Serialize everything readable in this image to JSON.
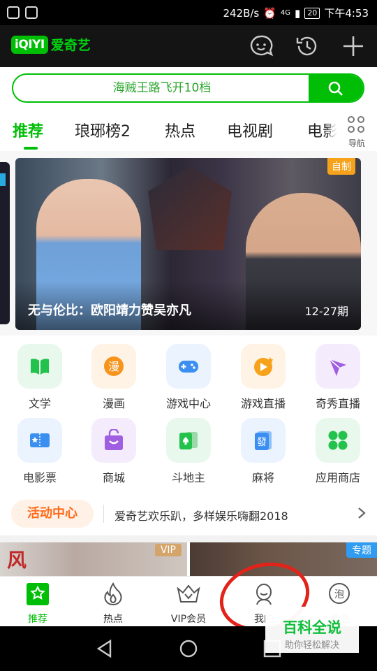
{
  "status": {
    "net_speed": "242B/s",
    "signal": "4G",
    "battery": "20",
    "time": "下午4:53"
  },
  "header": {
    "logo_mark": "iQIYI",
    "logo_name": "爱奇艺",
    "icons": [
      "message-icon",
      "history-icon",
      "plus-icon"
    ]
  },
  "search": {
    "placeholder": "海贼王路飞开10档"
  },
  "tabs": [
    {
      "label": "推荐"
    },
    {
      "label": "琅琊榜2"
    },
    {
      "label": "热点"
    },
    {
      "label": "电视剧"
    },
    {
      "label": "电影"
    }
  ],
  "nav": {
    "label": "导航"
  },
  "banner": {
    "tag": "自制",
    "title": "无与伦比：欧阳靖力赞吴亦凡",
    "episode": "12-27期"
  },
  "grid": [
    {
      "label": "文学",
      "icon": "book-icon",
      "color": "#22c24c"
    },
    {
      "label": "漫画",
      "icon": "comic-icon",
      "color": "#f6941d"
    },
    {
      "label": "游戏中心",
      "icon": "gamepad-icon",
      "color": "#3b8ff0"
    },
    {
      "label": "游戏直播",
      "icon": "play-star-icon",
      "color": "#f7a21b"
    },
    {
      "label": "奇秀直播",
      "icon": "star-fan-icon",
      "color": "#a05ee0"
    },
    {
      "label": "电影票",
      "icon": "ticket-icon",
      "color": "#3b8ff0"
    },
    {
      "label": "商城",
      "icon": "bag-icon",
      "color": "#a05ee0"
    },
    {
      "label": "斗地主",
      "icon": "cards-icon",
      "color": "#22c24c"
    },
    {
      "label": "麻将",
      "icon": "mahjong-icon",
      "color": "#3b8ff0"
    },
    {
      "label": "应用商店",
      "icon": "apps-icon",
      "color": "#22c24c"
    }
  ],
  "activity": {
    "badge": "活动中心",
    "text": "爱奇艺欢乐趴，多样娱乐嗨翻2018"
  },
  "thumbs": {
    "vip_tag": "VIP",
    "topic_tag": "专题"
  },
  "bottom_nav": [
    {
      "label": "推荐",
      "icon": "home-star-icon"
    },
    {
      "label": "热点",
      "icon": "flame-icon"
    },
    {
      "label": "VIP会员",
      "icon": "crown-icon"
    },
    {
      "label": "我的",
      "icon": "user-icon"
    },
    {
      "label": "泡泡",
      "icon": "bubble-icon"
    }
  ],
  "watermark": {
    "title": "百科全说",
    "subtitle": "助你轻松解决"
  }
}
